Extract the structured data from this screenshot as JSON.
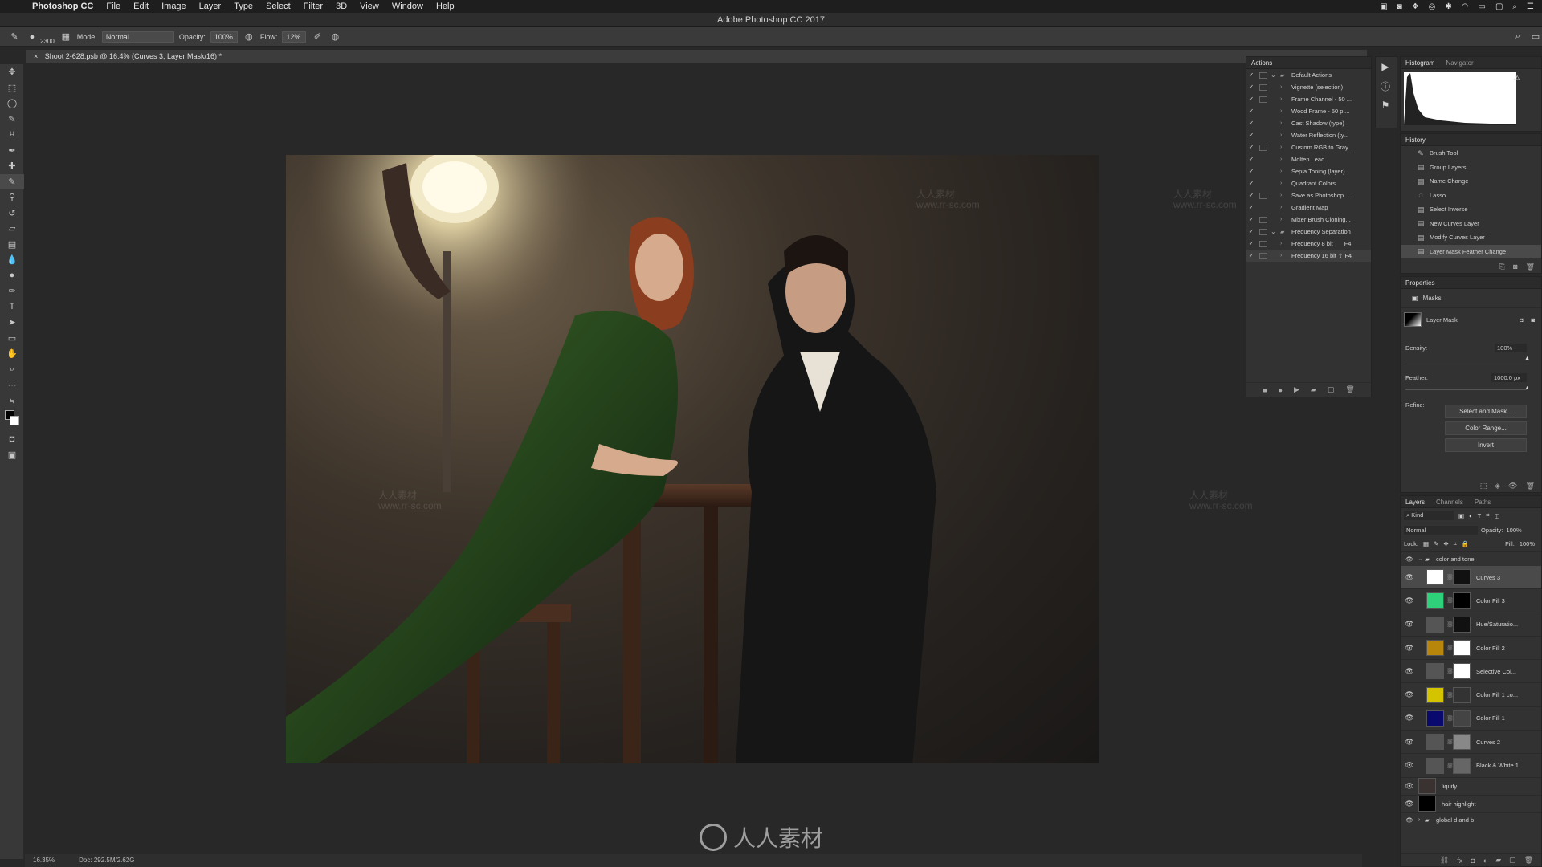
{
  "menubar": {
    "app": "Photoshop CC",
    "items": [
      "File",
      "Edit",
      "Image",
      "Layer",
      "Type",
      "Select",
      "Filter",
      "3D",
      "View",
      "Window",
      "Help"
    ]
  },
  "watermark": {
    "url": "www.rr-sc.com",
    "cn": "人人素材"
  },
  "window_title": "Adobe Photoshop CC 2017",
  "options": {
    "brush_size": "2300",
    "mode_label": "Mode:",
    "mode_value": "Normal",
    "opacity_label": "Opacity:",
    "opacity_value": "100%",
    "flow_label": "Flow:",
    "flow_value": "12%"
  },
  "document_tab": "Shoot 2-628.psb @ 16.4% (Curves 3, Layer Mask/16) *",
  "status": {
    "zoom": "16.35%",
    "doc": "Doc: 292.5M/2.62G"
  },
  "actions_panel": {
    "title": "Actions",
    "rows": [
      {
        "label": "Default Actions",
        "box": true,
        "folder": true
      },
      {
        "label": "Vignette (selection)",
        "box": true
      },
      {
        "label": "Frame Channel - 50 ...",
        "box": true
      },
      {
        "label": "Wood Frame - 50 pi...",
        "box": false
      },
      {
        "label": "Cast Shadow (type)",
        "box": false
      },
      {
        "label": "Water Reflection (ty...",
        "box": false
      },
      {
        "label": "Custom RGB to Gray...",
        "box": true
      },
      {
        "label": "Molten Lead",
        "box": false
      },
      {
        "label": "Sepia Toning (layer)",
        "box": false
      },
      {
        "label": "Quadrant Colors",
        "box": false
      },
      {
        "label": "Save as Photoshop ...",
        "box": true
      },
      {
        "label": "Gradient Map",
        "box": false
      },
      {
        "label": "Mixer Brush Cloning...",
        "box": true
      },
      {
        "label": "Frequency Separation",
        "box": true,
        "folder": true
      },
      {
        "label": "Frequency 8 bit",
        "box": true,
        "key": "F4"
      },
      {
        "label": "Frequency 16 bit ⇧ F4",
        "box": true,
        "selected": true
      }
    ]
  },
  "histogram_panel": {
    "tabs": [
      "Histogram",
      "Navigator"
    ]
  },
  "history_panel": {
    "title": "History",
    "rows": [
      {
        "label": "Brush Tool",
        "icon": "✎"
      },
      {
        "label": "Group Layers",
        "icon": "▤"
      },
      {
        "label": "Name Change",
        "icon": "▤"
      },
      {
        "label": "Lasso",
        "icon": "◌"
      },
      {
        "label": "Select Inverse",
        "icon": "▤"
      },
      {
        "label": "New Curves Layer",
        "icon": "▤"
      },
      {
        "label": "Modify Curves Layer",
        "icon": "▤"
      },
      {
        "label": "Layer Mask Feather Change",
        "icon": "▤",
        "active": true
      }
    ]
  },
  "properties_panel": {
    "title": "Properties",
    "section": "Masks",
    "layer_mask": "Layer Mask",
    "density_label": "Density:",
    "density_value": "100%",
    "feather_label": "Feather:",
    "feather_value": "1000.0 px",
    "refine_label": "Refine:",
    "buttons": [
      "Select and Mask...",
      "Color Range...",
      "Invert"
    ]
  },
  "layers_panel": {
    "tabs": [
      "Layers",
      "Channels",
      "Paths"
    ],
    "filter": "Kind",
    "blend": "Normal",
    "opacity_label": "Opacity:",
    "opacity_value": "100%",
    "lock_label": "Lock:",
    "fill_label": "Fill:",
    "fill_value": "100%",
    "group_top": "color and tone",
    "layers": [
      {
        "name": "Curves 3",
        "thumb": "#ffffff",
        "mask": "#111111",
        "active": true
      },
      {
        "name": "Color Fill 3",
        "thumb": "#2fd07a",
        "mask": "#000000"
      },
      {
        "name": "Hue/Saturatio...",
        "thumb": "#555555",
        "mask": "#111111"
      },
      {
        "name": "Color Fill 2",
        "thumb": "#b8860b",
        "mask": "#ffffff"
      },
      {
        "name": "Selective Col...",
        "thumb": "#555555",
        "mask": "#ffffff"
      },
      {
        "name": "Color Fill 1 co...",
        "thumb": "#d4c400",
        "mask": "#333333"
      },
      {
        "name": "Color Fill 1",
        "thumb": "#0a0a6e",
        "mask": "#444444"
      },
      {
        "name": "Curves 2",
        "thumb": "#555555",
        "mask": "#888888"
      },
      {
        "name": "Black & White 1",
        "thumb": "#555555",
        "mask": "#666666"
      }
    ],
    "plain_layers": [
      {
        "name": "liquify"
      },
      {
        "name": "hair highlight"
      }
    ],
    "group_bottom": "global d and b"
  }
}
